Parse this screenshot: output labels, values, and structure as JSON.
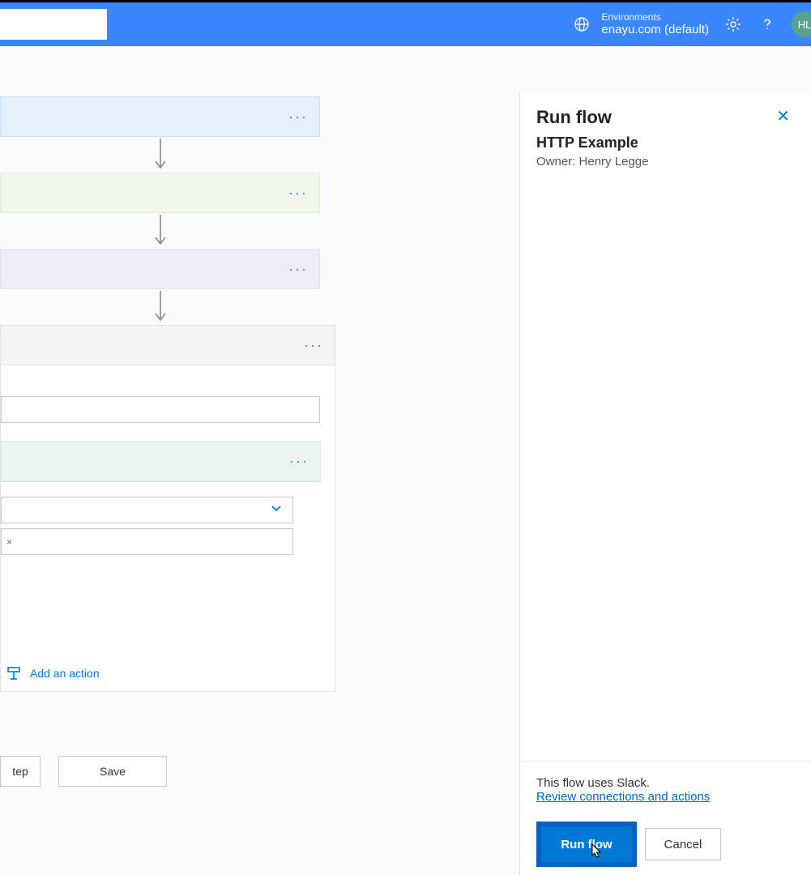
{
  "header": {
    "env_label": "Environments",
    "env_value": "enayu.com (default)",
    "avatar_initials": "HL"
  },
  "panel": {
    "title": "Run flow",
    "subtitle": "HTTP Example",
    "owner_line": "Owner: Henry Legge",
    "note": "This flow uses Slack.",
    "review_link": "Review connections and actions",
    "run_label": "Run flow",
    "cancel_label": "Cancel"
  },
  "canvas": {
    "add_action_label": "Add an action",
    "step_button": "tep",
    "save_button": "Save",
    "tag_close": "×"
  }
}
